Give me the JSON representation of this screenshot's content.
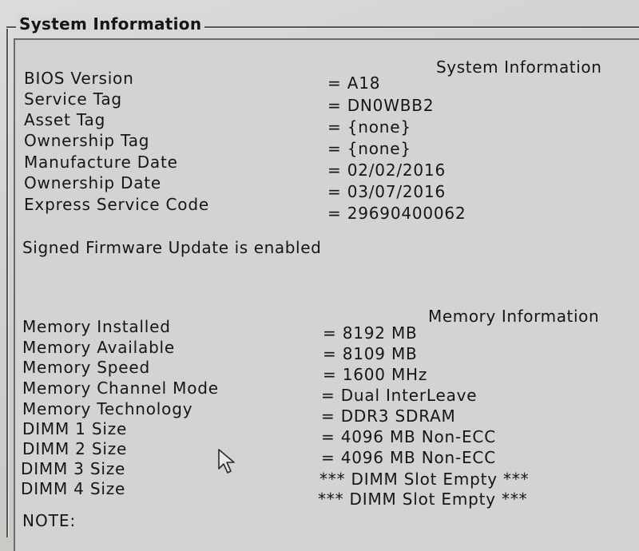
{
  "window": {
    "group_title": "System Information"
  },
  "system": {
    "heading": "System Information",
    "rows": [
      {
        "label": "BIOS Version",
        "value": "= A18"
      },
      {
        "label": "Service Tag",
        "value": "= DN0WBB2"
      },
      {
        "label": "Asset Tag",
        "value": "= {none}"
      },
      {
        "label": "Ownership Tag",
        "value": "= {none}"
      },
      {
        "label": "Manufacture Date",
        "value": "= 02/02/2016"
      },
      {
        "label": "Ownership Date",
        "value": "= 03/07/2016"
      },
      {
        "label": "Express Service Code",
        "value": "= 29690400062"
      }
    ],
    "firmware_note": "Signed Firmware Update is enabled"
  },
  "memory": {
    "heading": "Memory Information",
    "rows": [
      {
        "label": "Memory Installed",
        "value": "= 8192 MB"
      },
      {
        "label": "Memory Available",
        "value": "= 8109 MB"
      },
      {
        "label": "Memory Speed",
        "value": "= 1600 MHz"
      },
      {
        "label": "Memory Channel Mode",
        "value": "= Dual InterLeave"
      },
      {
        "label": "Memory Technology",
        "value": "= DDR3 SDRAM"
      },
      {
        "label": "DIMM 1 Size",
        "value": "= 4096 MB Non-ECC"
      },
      {
        "label": "DIMM 2 Size",
        "value": "= 4096 MB Non-ECC"
      },
      {
        "label": "DIMM 3 Size",
        "value": "*** DIMM Slot Empty ***"
      },
      {
        "label": "DIMM 4 Size",
        "value": "*** DIMM Slot Empty ***"
      }
    ]
  },
  "footer": {
    "partial_text": "NOTE:"
  },
  "icons": {
    "cursor": "mouse-pointer-icon"
  }
}
